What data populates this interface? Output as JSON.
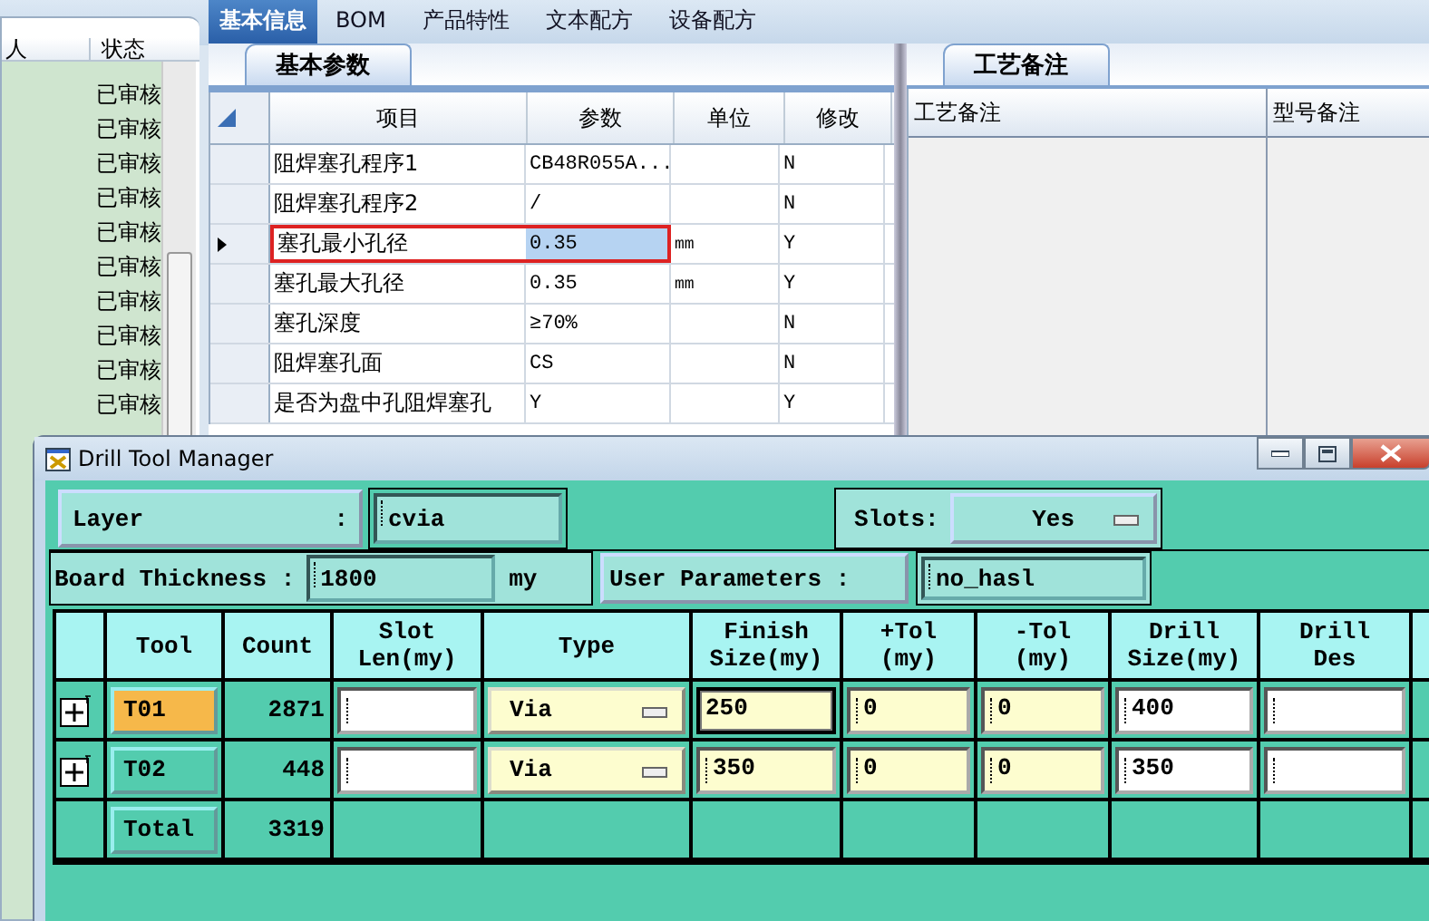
{
  "left_list": {
    "columns": [
      "人",
      "状态"
    ],
    "rows": [
      "已审核",
      "已审核",
      "已审核",
      "已审核",
      "已审核",
      "已审核",
      "已审核",
      "已审核",
      "已审核",
      "已审核"
    ]
  },
  "tabs": [
    {
      "label": "基本信息",
      "selected": true
    },
    {
      "label": "BOM",
      "selected": false
    },
    {
      "label": "产品特性",
      "selected": false
    },
    {
      "label": "文本配方",
      "selected": false
    },
    {
      "label": "设备配方",
      "selected": false
    }
  ],
  "basic_params": {
    "tab": "基本参数",
    "columns": [
      "项目",
      "参数",
      "单位",
      "修改"
    ],
    "rows": [
      {
        "item": "阻焊塞孔程序1",
        "value": "CB48R055A...",
        "modify": "N",
        "selected": false
      },
      {
        "item": "阻焊塞孔程序2",
        "value": "/",
        "modify": "N",
        "selected": false
      },
      {
        "item": "塞孔最小孔径",
        "value": "0.35",
        "unit": "mm",
        "modify": "Y",
        "selected": true
      },
      {
        "item": "塞孔最大孔径",
        "value": "0.35",
        "unit": "mm",
        "modify": "Y",
        "selected": false
      },
      {
        "item": "塞孔深度",
        "value": "≥70%",
        "modify": "N",
        "selected": false
      },
      {
        "item": "阻焊塞孔面",
        "value": "CS",
        "modify": "N",
        "selected": false
      },
      {
        "item": "是否为盘中孔阻焊塞孔",
        "value": "Y",
        "modify": "Y",
        "selected": false
      }
    ]
  },
  "remarks": {
    "tab": "工艺备注",
    "columns": [
      "工艺备注",
      "型号备注"
    ]
  },
  "drill_window": {
    "title": "Drill Tool Manager",
    "layer_label": "Layer",
    "layer_colon": ":",
    "layer": "cvia",
    "slots_label": "Slots:",
    "slots": "Yes",
    "thickness_label": "Board Thickness :",
    "thickness": "1800",
    "thickness_unit": "my",
    "user_params_button": "User Parameters :",
    "user_params": "no_hasl",
    "columns": [
      "Tool",
      "Count",
      "Slot\nLen(my)",
      "Type",
      "Finish\nSize(my)",
      "+Tol\n(my)",
      "-Tol\n(my)",
      "Drill\nSize(my)",
      "Drill\nDes"
    ],
    "tools": [
      {
        "tool": "T01",
        "count": "2871",
        "type": "Via",
        "finish": "250",
        "plus_tol": "0",
        "minus_tol": "0",
        "drill": "400",
        "selected": true
      },
      {
        "tool": "T02",
        "count": "448",
        "type": "Via",
        "finish": "350",
        "plus_tol": "0",
        "minus_tol": "0",
        "drill": "350",
        "selected": false
      }
    ],
    "total_label": "Total",
    "total": "3319"
  }
}
